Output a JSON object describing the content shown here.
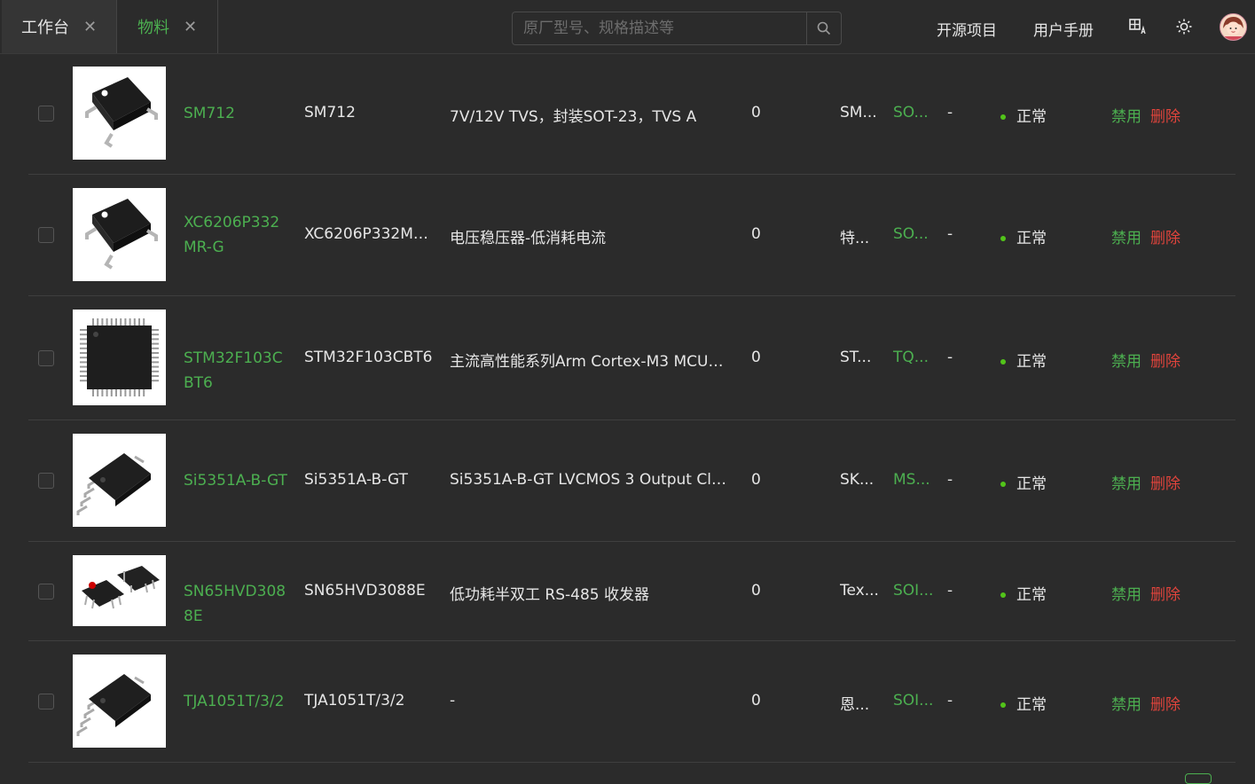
{
  "tabs": [
    {
      "label": "工作台",
      "close": "✕"
    },
    {
      "label": "物料",
      "close": "✕"
    }
  ],
  "search": {
    "placeholder": "原厂型号、规格描述等"
  },
  "nav": {
    "open_source": "开源项目",
    "manual": "用户手册"
  },
  "colors": {
    "accent": "#4caf50",
    "danger": "#e0443c",
    "status_dot": "#52c41a",
    "background": "#2b2b2b"
  },
  "icons": [
    "search-icon",
    "translate-icon",
    "sun-icon",
    "user-avatar"
  ],
  "rows": [
    {
      "part_link": "SM712",
      "model": "SM712",
      "desc": "7V/12V TVS，封装SOT-23，TVS A",
      "qty": "0",
      "maker": "SM...",
      "pkg": "SO...",
      "dash": "-",
      "status": "正常",
      "disable": "禁用",
      "delete": "删除",
      "thumb": "sot23"
    },
    {
      "part_link": "XC6206P332MR-G",
      "model": "XC6206P332MR-G",
      "desc": "电压稳压器-低消耗电流",
      "qty": "0",
      "maker": "特...",
      "pkg": "SO...",
      "dash": "-",
      "status": "正常",
      "disable": "禁用",
      "delete": "删除",
      "thumb": "sot23"
    },
    {
      "part_link": "STM32F103CBT6",
      "model": "STM32F103CBT6",
      "desc": "主流高性能系列Arm Cortex-M3 MCU，...",
      "qty": "0",
      "maker": "ST...",
      "pkg": "TQ...",
      "dash": "-",
      "status": "正常",
      "disable": "禁用",
      "delete": "删除",
      "thumb": "qfp"
    },
    {
      "part_link": "Si5351A-B-GT",
      "model": "Si5351A-B-GT",
      "desc": "Si5351A-B-GT LVCMOS 3 Output Clock ...",
      "qty": "0",
      "maker": "SK...",
      "pkg": "MS...",
      "dash": "-",
      "status": "正常",
      "disable": "禁用",
      "delete": "删除",
      "thumb": "msop"
    },
    {
      "part_link": "SN65HVD3088E",
      "model": "SN65HVD3088E",
      "desc": "低功耗半双工 RS-485 收发器",
      "qty": "0",
      "maker": "Tex...",
      "pkg": "SOI...",
      "dash": "-",
      "status": "正常",
      "disable": "禁用",
      "delete": "删除",
      "thumb": "soic2"
    },
    {
      "part_link": "TJA1051T/3/2",
      "model": "TJA1051T/3/2",
      "desc": "-",
      "qty": "0",
      "maker": "恩...",
      "pkg": "SOI...",
      "dash": "-",
      "status": "正常",
      "disable": "禁用",
      "delete": "删除",
      "thumb": "soic"
    }
  ]
}
